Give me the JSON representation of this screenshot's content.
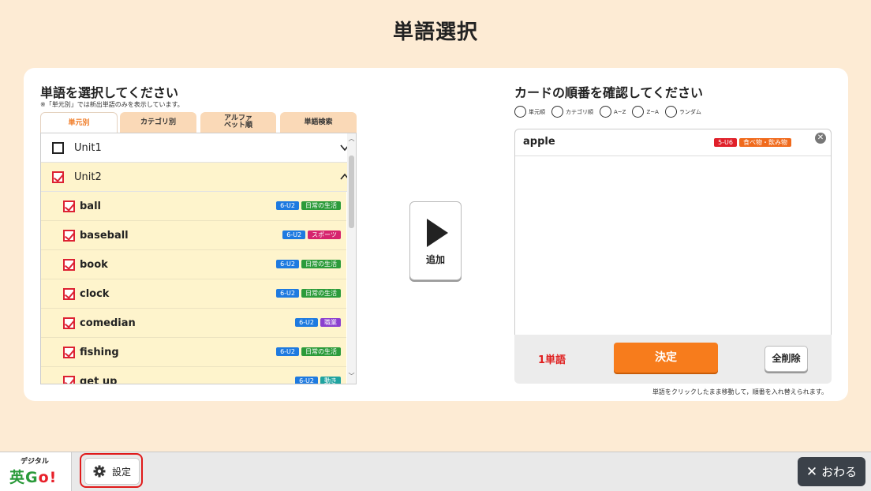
{
  "page": {
    "title": "単語選択"
  },
  "left": {
    "heading": "単語を選択してください",
    "note": "※「単元別」では新出単語のみを表示しています。",
    "tabs": [
      {
        "label": "単元別",
        "active": true
      },
      {
        "label": "カテゴリ別",
        "active": false
      },
      {
        "label": "アルファ\nベット順",
        "active": false
      },
      {
        "label": "単語検索",
        "active": false
      }
    ],
    "units": [
      {
        "label": "Unit1",
        "checked": false,
        "expanded": false
      },
      {
        "label": "Unit2",
        "checked": true,
        "expanded": true
      }
    ],
    "words": [
      {
        "label": "ball",
        "checked": true,
        "tags": [
          {
            "text": "6-U2",
            "color": "#1e7ae0"
          },
          {
            "text": "日常の生活",
            "color": "#2c9b3a"
          }
        ]
      },
      {
        "label": "baseball",
        "checked": true,
        "tags": [
          {
            "text": "6-U2",
            "color": "#1e7ae0"
          },
          {
            "text": "スポーツ",
            "color": "#d6246e"
          }
        ]
      },
      {
        "label": "book",
        "checked": true,
        "tags": [
          {
            "text": "6-U2",
            "color": "#1e7ae0"
          },
          {
            "text": "日常の生活",
            "color": "#2c9b3a"
          }
        ]
      },
      {
        "label": "clock",
        "checked": true,
        "tags": [
          {
            "text": "6-U2",
            "color": "#1e7ae0"
          },
          {
            "text": "日常の生活",
            "color": "#2c9b3a"
          }
        ]
      },
      {
        "label": "comedian",
        "checked": true,
        "tags": [
          {
            "text": "6-U2",
            "color": "#1e7ae0"
          },
          {
            "text": "職業",
            "color": "#8b3fcf"
          }
        ]
      },
      {
        "label": "fishing",
        "checked": true,
        "tags": [
          {
            "text": "6-U2",
            "color": "#1e7ae0"
          },
          {
            "text": "日常の生活",
            "color": "#2c9b3a"
          }
        ]
      },
      {
        "label": "get up",
        "checked": true,
        "tags": [
          {
            "text": "6-U2",
            "color": "#1e7ae0"
          },
          {
            "text": "動き",
            "color": "#1fa3a0"
          }
        ]
      }
    ]
  },
  "add_button": {
    "label": "追加"
  },
  "right": {
    "heading": "カードの順番を確認してください",
    "sort_options": [
      "単元順",
      "カテゴリ順",
      "A~Z",
      "Z~A",
      "ランダム"
    ],
    "cards": [
      {
        "word": "apple",
        "tags": [
          {
            "text": "5-U6",
            "color": "#e0202a"
          },
          {
            "text": "食べ物・飲み物",
            "color": "#f06a1c"
          }
        ]
      }
    ],
    "count": "1単語",
    "confirm_label": "決定",
    "clear_label": "全削除",
    "hint": "単語をクリックしたまま移動して，順番を入れ替えられます。"
  },
  "bottom": {
    "logo_top": "デジタル",
    "logo_main_a": "英G",
    "logo_main_b": "o!",
    "settings_label": "設定",
    "close_label": "おわる",
    "close_glyph": "✕"
  }
}
